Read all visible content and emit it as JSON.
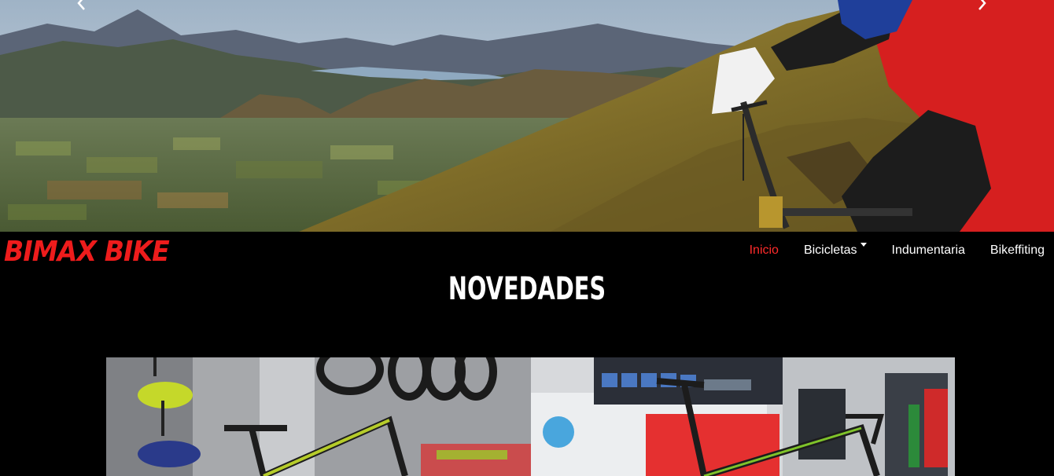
{
  "hero": {
    "prev_icon": "chevron-left-icon",
    "next_icon": "chevron-right-icon"
  },
  "navbar": {
    "brand": "BIMAX BIKE",
    "brand_color": "#ee1c1c",
    "active_color": "#ff2b2b",
    "links": [
      {
        "label": "Inicio",
        "active": true
      },
      {
        "label": "Bicicletas",
        "dropdown": true
      },
      {
        "label": "Indumentaria"
      },
      {
        "label": "Bikeffiting"
      }
    ]
  },
  "section": {
    "title": "NOVEDADES"
  }
}
